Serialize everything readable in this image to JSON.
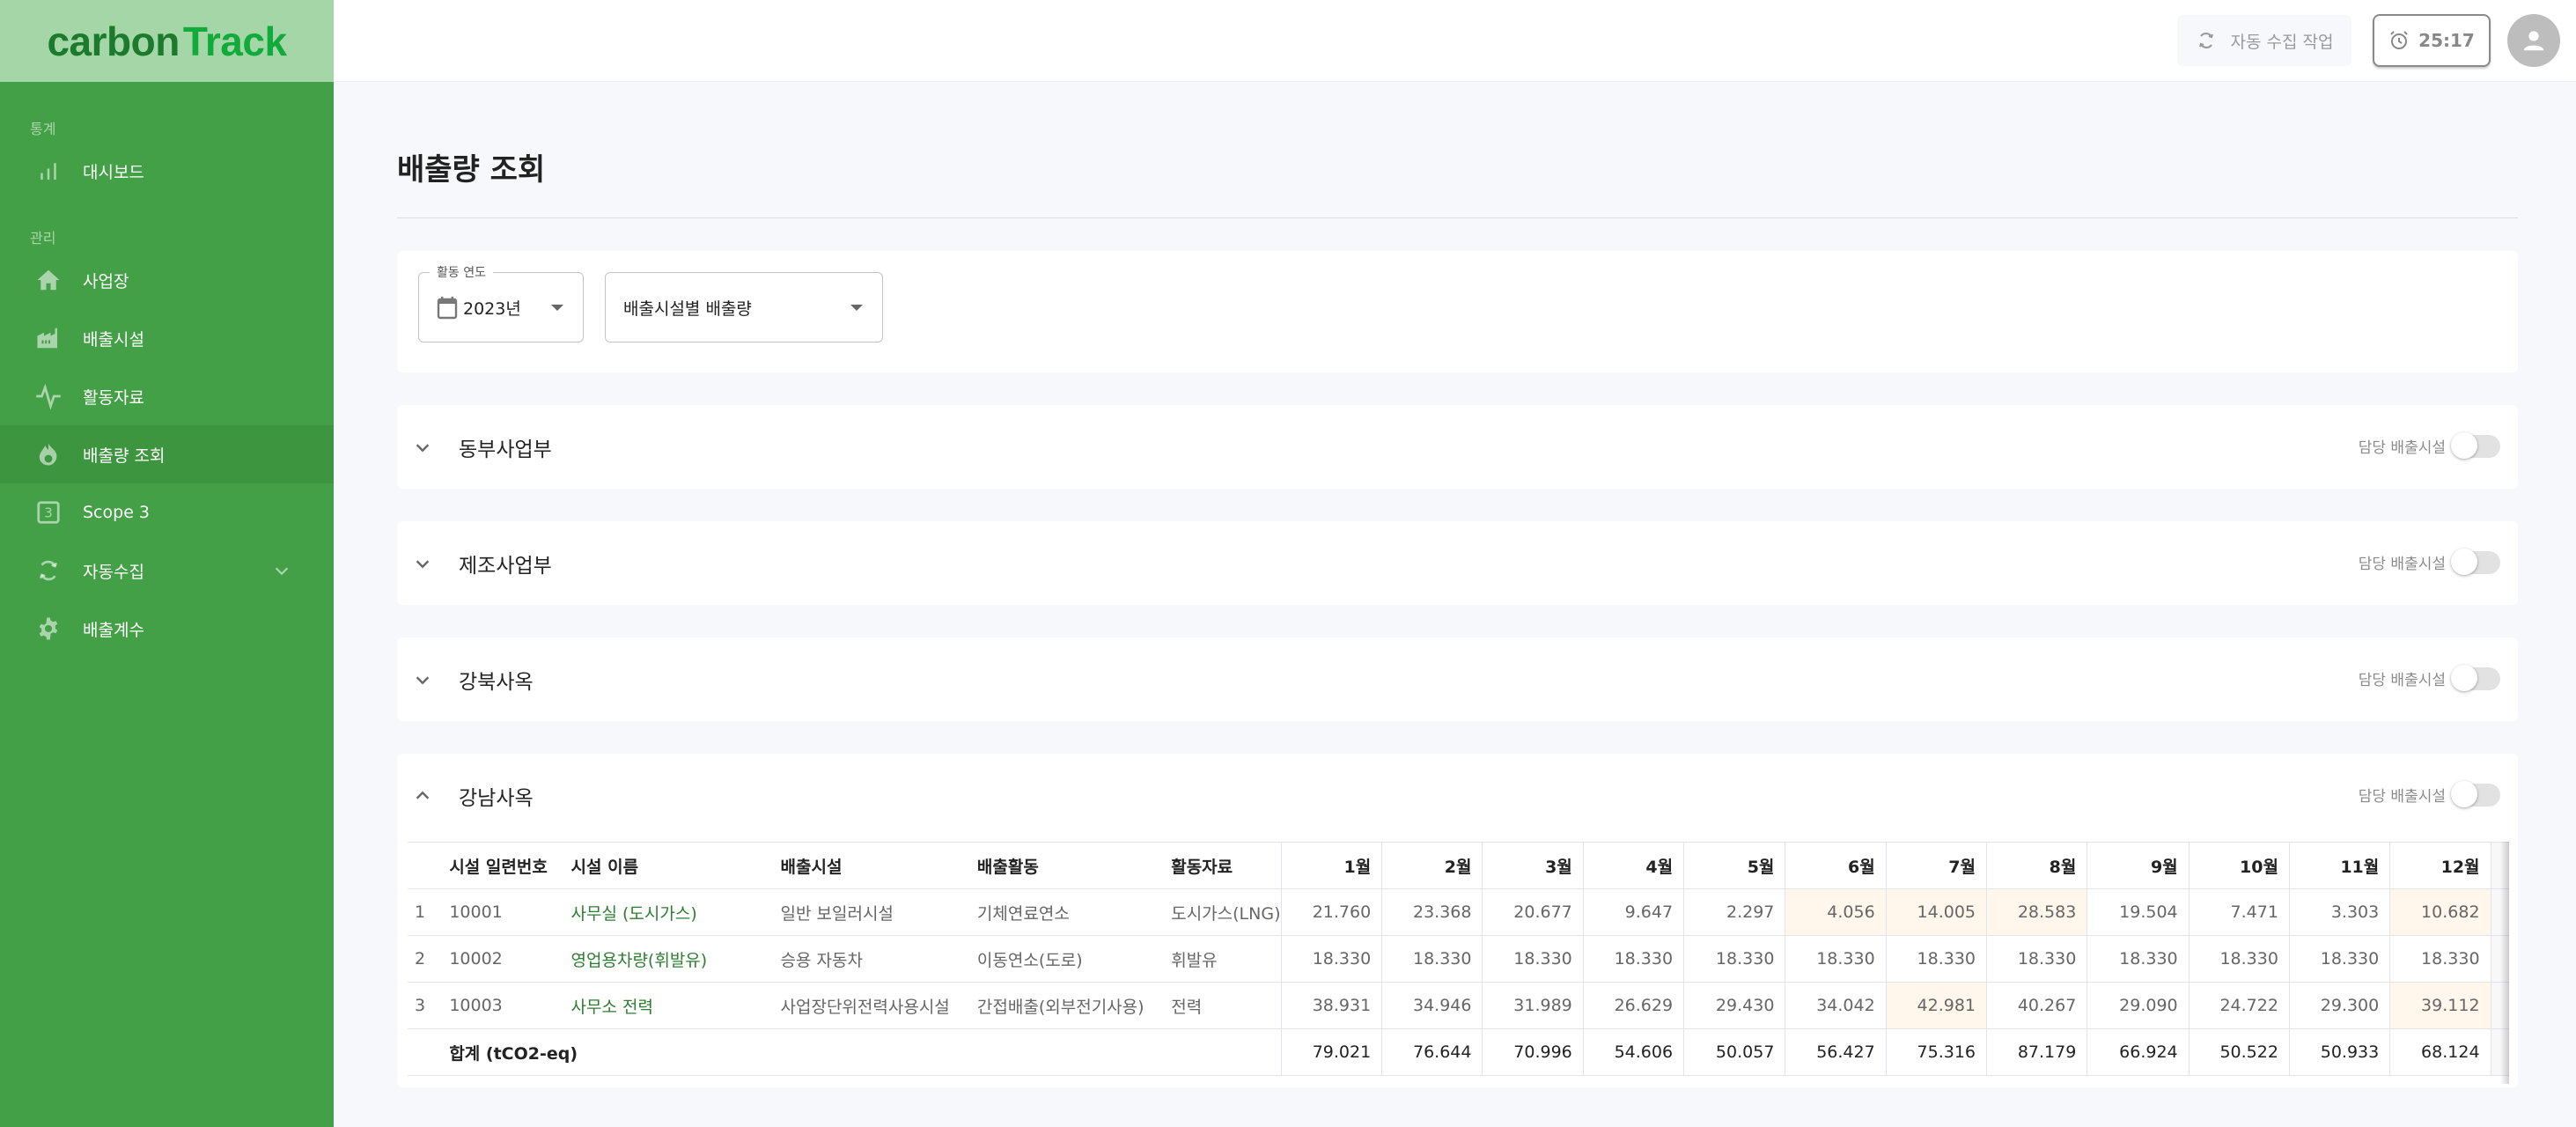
{
  "logo": {
    "part1": "carbon",
    "part2": "Track"
  },
  "sidebar": {
    "sections": [
      {
        "label": "통계",
        "items": [
          {
            "label": "대시보드",
            "icon": "bar-chart-icon"
          }
        ]
      },
      {
        "label": "관리",
        "items": [
          {
            "label": "사업장",
            "icon": "home-icon"
          },
          {
            "label": "배출시설",
            "icon": "factory-icon"
          },
          {
            "label": "활동자료",
            "icon": "activity-icon"
          },
          {
            "label": "배출량 조회",
            "icon": "fire-icon",
            "active": true
          },
          {
            "label": "Scope 3",
            "icon": "scope3-icon"
          },
          {
            "label": "자동수집",
            "icon": "sync-icon",
            "expandable": true
          },
          {
            "label": "배출계수",
            "icon": "gear-icon"
          }
        ]
      }
    ]
  },
  "header": {
    "auto_collect_label": "자동 수집 작업",
    "timer": "25:17"
  },
  "page": {
    "title": "배출량 조회"
  },
  "filters": {
    "year_label": "활동 연도",
    "year_value": "2023년",
    "view_value": "배출시설별 배출량"
  },
  "sections": [
    {
      "title": "동부사업부",
      "expanded": false,
      "toggle_label": "담당 배출시설",
      "toggle_on": false
    },
    {
      "title": "제조사업부",
      "expanded": false,
      "toggle_label": "담당 배출시설",
      "toggle_on": false
    },
    {
      "title": "강북사옥",
      "expanded": false,
      "toggle_label": "담당 배출시설",
      "toggle_on": false
    },
    {
      "title": "강남사옥",
      "expanded": true,
      "toggle_label": "담당 배출시설",
      "toggle_on": false
    }
  ],
  "table": {
    "headers": {
      "index": "",
      "serial": "시설 일련번호",
      "name": "시설 이름",
      "facility": "배출시설",
      "activity": "배출활동",
      "data": "활동자료",
      "months": [
        "1월",
        "2월",
        "3월",
        "4월",
        "5월",
        "6월",
        "7월",
        "8월",
        "9월",
        "10월",
        "11월",
        "12월"
      ],
      "total": ""
    },
    "rows": [
      {
        "index": "1",
        "serial": "10001",
        "name": "사무실 (도시가스)",
        "facility": "일반 보일러시설",
        "activity": "기체연료연소",
        "data": "도시가스(LNG)",
        "months": [
          "21.760",
          "23.368",
          "20.677",
          "9.647",
          "2.297",
          "4.056",
          "14.005",
          "28.583",
          "19.504",
          "7.471",
          "3.303",
          "10.682"
        ],
        "highlighted_months": [
          6,
          7,
          8,
          12
        ],
        "total_visible": "1"
      },
      {
        "index": "2",
        "serial": "10002",
        "name": "영업용차량(휘발유)",
        "facility": "승용 자동차",
        "activity": "이동연소(도로)",
        "data": "휘발유",
        "months": [
          "18.330",
          "18.330",
          "18.330",
          "18.330",
          "18.330",
          "18.330",
          "18.330",
          "18.330",
          "18.330",
          "18.330",
          "18.330",
          "18.330"
        ],
        "highlighted_months": [],
        "total_visible": "1"
      },
      {
        "index": "3",
        "serial": "10003",
        "name": "사무소 전력",
        "facility": "사업장단위전력사용시설",
        "activity": "간접배출(외부전기사용)",
        "data": "전력",
        "months": [
          "38.931",
          "34.946",
          "31.989",
          "26.629",
          "29.430",
          "34.042",
          "42.981",
          "40.267",
          "29.090",
          "24.722",
          "29.300",
          "39.112"
        ],
        "highlighted_months": [
          7,
          12
        ],
        "total_visible": "3"
      }
    ],
    "sum": {
      "label": "합계 (tCO2-eq)",
      "months": [
        "79.021",
        "76.644",
        "70.996",
        "54.606",
        "50.057",
        "56.427",
        "75.316",
        "87.179",
        "66.924",
        "50.522",
        "50.933",
        "68.124"
      ],
      "total_visible": "6"
    }
  },
  "colors": {
    "sidebar_bg": "#43a047",
    "logo_bg": "#a5d6a7",
    "active_item_bg": "#3d963f",
    "link_green": "#2e7d32",
    "highlight_cell": "#fff6ec"
  }
}
